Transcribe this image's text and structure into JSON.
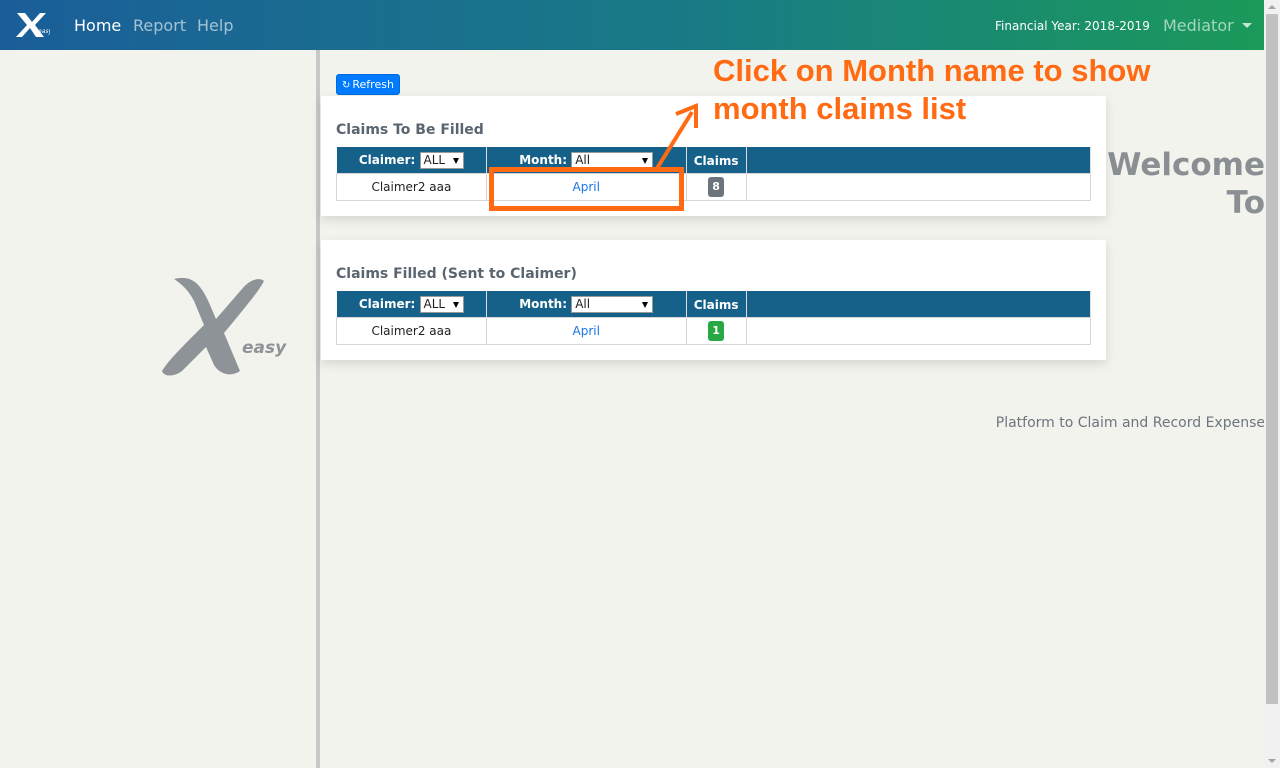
{
  "navbar": {
    "logo_label": "easy",
    "links": [
      "Home",
      "Report",
      "Help"
    ],
    "financial_year": "Financial Year: 2018-2019",
    "user_menu": "Mediator"
  },
  "sidebar": {
    "welcome_line1": "Welcome",
    "welcome_line2": "To",
    "logo_text": "easy",
    "tagline": "Platform to Claim and Record Expense"
  },
  "main": {
    "refresh_label": "Refresh",
    "to_be_filled": {
      "title": "Claims To Be Filled",
      "claimer_header": "Claimer:",
      "claimer_filter": "ALL",
      "month_header": "Month:",
      "month_filter": "All",
      "claims_header": "Claims",
      "rows": [
        {
          "claimer": "Claimer2 aaa",
          "month": "April",
          "claims": "8"
        }
      ]
    },
    "filled": {
      "title": "Claims Filled (Sent to Claimer)",
      "claimer_header": "Claimer:",
      "claimer_filter": "ALL",
      "month_header": "Month:",
      "month_filter": "All",
      "claims_header": "Claims",
      "rows": [
        {
          "claimer": "Claimer2 aaa",
          "month": "April",
          "claims": "1"
        }
      ]
    }
  },
  "annotation": {
    "callout_line1": "Click on Month name to show",
    "callout_line2": "month claims list",
    "color": "#ff6a13"
  },
  "colors": {
    "table_header": "#15618a",
    "badge_pending": "#6c757d",
    "badge_filled": "#28a745",
    "primary": "#007bff"
  }
}
